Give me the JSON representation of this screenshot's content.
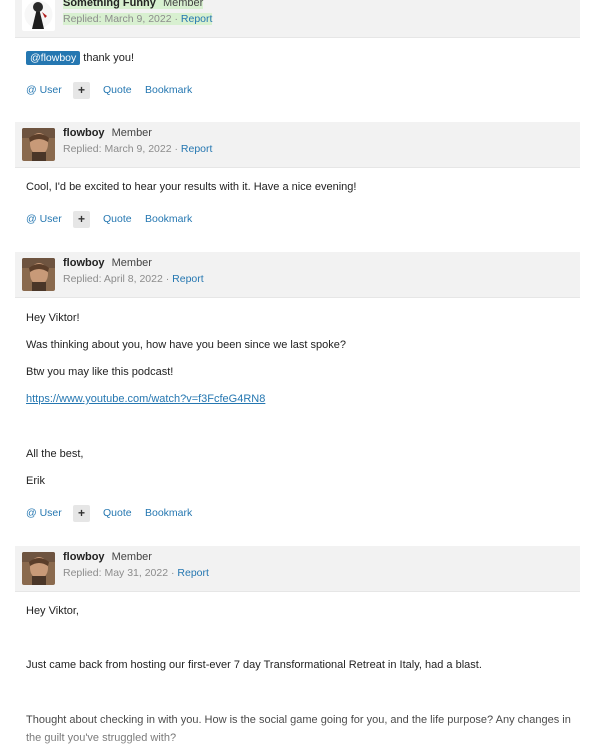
{
  "posts": [
    {
      "author": "Something Funny",
      "role": "Member",
      "replied": "Replied: March 9, 2022",
      "sep": " · ",
      "report": "Report",
      "mention": "@flowboy",
      "body": [
        "thank you!"
      ]
    },
    {
      "author": "flowboy",
      "role": "Member",
      "replied": "Replied: March 9, 2022",
      "sep": " · ",
      "report": "Report",
      "body": [
        "Cool, I'd be excited to hear your results with it. Have a nice evening!"
      ]
    },
    {
      "author": "flowboy",
      "role": "Member",
      "replied": "Replied: April 8, 2022",
      "sep": " · ",
      "report": "Report",
      "body": [
        "Hey Viktor!",
        "Was thinking about you, how have you been since we last spoke?",
        "Btw you may like this podcast!",
        "https://www.youtube.com/watch?v=f3FcfeG4RN8",
        "All the best,",
        "Erik"
      ]
    },
    {
      "author": "flowboy",
      "role": "Member",
      "replied": "Replied: May 31, 2022",
      "sep": " · ",
      "report": "Report",
      "body": [
        "Hey Viktor,",
        "Just came back from hosting our first-ever 7 day Transformational Retreat in Italy, had a blast.",
        "Thought about checking in with you. How is the social game going for you, and the life purpose? Any changes in",
        "the guilt you've struggled with?"
      ]
    }
  ],
  "actions": {
    "user": "@ User",
    "plus": "+",
    "quote": "Quote",
    "bookmark": "Bookmark"
  },
  "colors": {
    "link": "#2577b1",
    "header_bg": "#f2f2f2",
    "highlight": "#d8f0d0"
  }
}
